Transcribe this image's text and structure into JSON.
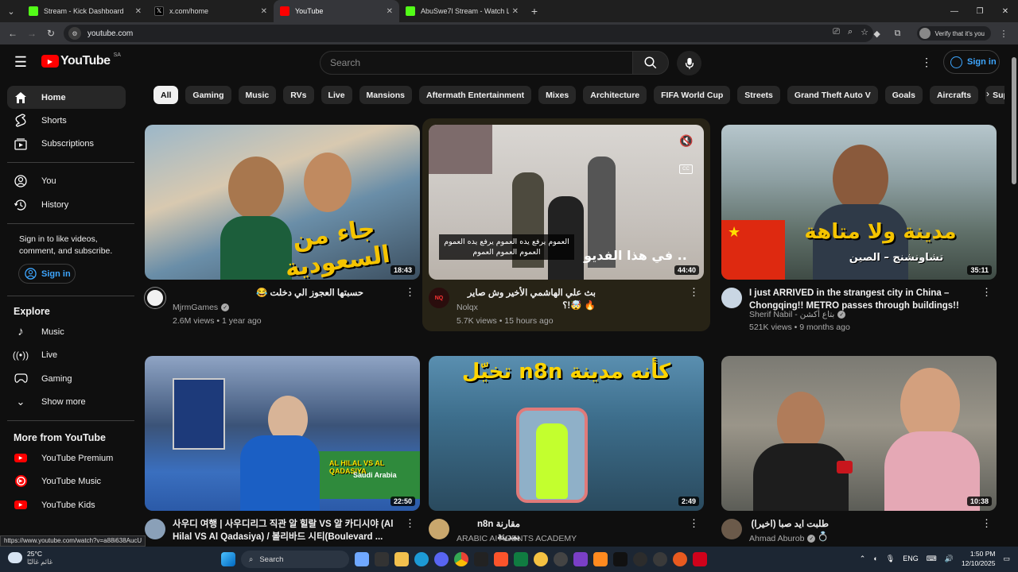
{
  "browser": {
    "tabs": [
      {
        "title": "Stream - Kick Dashboard",
        "color": "#53fc18",
        "active": false
      },
      {
        "title": "x.com/home",
        "color": "#000000",
        "active": false
      },
      {
        "title": "YouTube",
        "color": "#ff0000",
        "active": true
      },
      {
        "title": "AbuSwe7l Stream - Watch Live o",
        "color": "#53fc18",
        "active": false
      }
    ],
    "url": "youtube.com",
    "verify_label": "Verify that it's you"
  },
  "header": {
    "logo_text": "YouTube",
    "region": "SA",
    "search_placeholder": "Search",
    "signin_label": "Sign in"
  },
  "sidebar": {
    "main": [
      {
        "label": "Home",
        "icon": "home-icon"
      },
      {
        "label": "Shorts",
        "icon": "shorts-icon"
      },
      {
        "label": "Subscriptions",
        "icon": "subscriptions-icon"
      }
    ],
    "you": [
      {
        "label": "You",
        "icon": "user-icon"
      },
      {
        "label": "History",
        "icon": "history-icon"
      }
    ],
    "signin_prompt": "Sign in to like videos, comment, and subscribe.",
    "signin_label": "Sign in",
    "explore_title": "Explore",
    "explore": [
      {
        "label": "Music",
        "icon": "music-icon"
      },
      {
        "label": "Live",
        "icon": "live-icon"
      },
      {
        "label": "Gaming",
        "icon": "gaming-icon"
      },
      {
        "label": "Show more",
        "icon": "chevron-down-icon"
      }
    ],
    "more_title": "More from YouTube",
    "more": [
      {
        "label": "YouTube Premium",
        "icon": "youtube-premium-icon"
      },
      {
        "label": "YouTube Music",
        "icon": "youtube-music-icon"
      },
      {
        "label": "YouTube Kids",
        "icon": "youtube-kids-icon"
      }
    ]
  },
  "chips": [
    "All",
    "Gaming",
    "Music",
    "RVs",
    "Live",
    "Mansions",
    "Aftermath Entertainment",
    "Mixes",
    "Architecture",
    "FIFA World Cup",
    "Streets",
    "Grand Theft Auto V",
    "Goals",
    "Aircrafts",
    "Supercar"
  ],
  "videos": [
    {
      "title": "حسبتها العجوز الي دخلت 😂",
      "channel": "MjrmGames",
      "verified": true,
      "stats": "2.6M views • 1 year ago",
      "duration": "18:43",
      "thumb_text": "جاء من السعودية"
    },
    {
      "title": "بث علي الهاشمي الأخير وش صاير 🔥 🤯!؟",
      "channel": "Nolqx",
      "verified": false,
      "stats": "5.7K views • 15 hours ago",
      "duration": "44:40",
      "thumb_text": "في هذا الفديو ..",
      "caption": "العموم يرفع يده العموم يرفع يده العموم العموم العموم العموم"
    },
    {
      "title": "I just ARRIVED in the strangest city in China – Chongqing!! METRO passes through buildings!!",
      "channel": "Sherif Nabil - بتاع أكشن",
      "verified": true,
      "stats": "521K views • 9 months ago",
      "duration": "35:11",
      "thumb_text": "مدينة ولا متاهة",
      "thumb_sub": "تشاونشنج – الصين"
    },
    {
      "title": "사우디 여행 | 사우디리그 직관 알 힐랄 VS 알 카디시야 (Al Hilal VS Al Qadasiya) / 볼리바드 시티(Boulevard ...",
      "channel": "",
      "verified": false,
      "stats": "",
      "duration": "22:50",
      "thumb_text": "AL HILAL VS AL QADASIYA",
      "thumb_sub": "Saudi Arabia"
    },
    {
      "title": "مقارنة n8n بمدينة",
      "channel": "ARABIC AI AGENTS ACADEMY",
      "verified": false,
      "stats": "",
      "duration": "2:49",
      "thumb_text": "تخيّل n8n كأنه مدينة"
    },
    {
      "title": "طلبت ايد صبا (اخيرا) 💍",
      "channel": "Ahmad Aburob",
      "verified": true,
      "stats": "",
      "duration": "10:38",
      "thumb_text": ""
    }
  ],
  "status_url": "https://www.youtube.com/watch?v=a88i638AucU",
  "taskbar": {
    "temp": "25°C",
    "weather_desc": "غائم غالبًا",
    "search_label": "Search",
    "lang": "ENG",
    "time": "1:50 PM",
    "date": "12/10/2025"
  }
}
